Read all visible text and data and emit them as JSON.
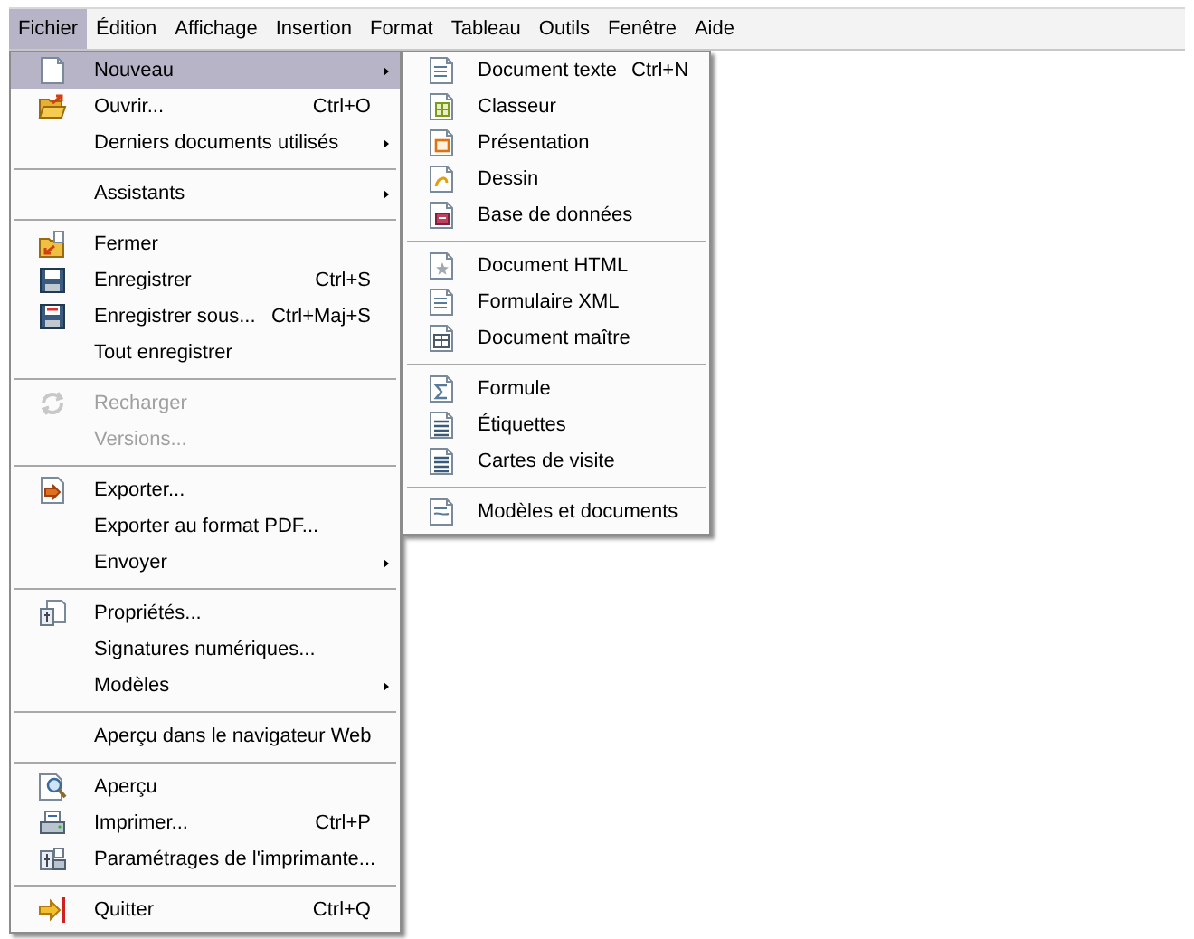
{
  "menu_bar": [
    {
      "label": "Fichier",
      "selected": true
    },
    {
      "label": "Édition",
      "selected": false
    },
    {
      "label": "Affichage",
      "selected": false
    },
    {
      "label": "Insertion",
      "selected": false
    },
    {
      "label": "Format",
      "selected": false
    },
    {
      "label": "Tableau",
      "selected": false
    },
    {
      "label": "Outils",
      "selected": false
    },
    {
      "label": "Fenêtre",
      "selected": false
    },
    {
      "label": "Aide",
      "selected": false
    }
  ],
  "file_menu": {
    "items": [
      {
        "kind": "item",
        "label": "Nouveau",
        "has_submenu": true,
        "disabled": false,
        "selected": true
      },
      {
        "kind": "item",
        "label": "Ouvrir...",
        "shortcut": "Ctrl+O",
        "has_submenu": false,
        "disabled": false,
        "selected": false
      },
      {
        "kind": "item",
        "label": "Derniers documents utilisés",
        "has_submenu": true,
        "disabled": false,
        "selected": false
      },
      {
        "kind": "separator"
      },
      {
        "kind": "item",
        "label": "Assistants",
        "has_submenu": true,
        "disabled": false,
        "selected": false
      },
      {
        "kind": "separator"
      },
      {
        "kind": "item",
        "label": "Fermer",
        "has_submenu": false,
        "disabled": false,
        "selected": false
      },
      {
        "kind": "item",
        "label": "Enregistrer",
        "shortcut": "Ctrl+S",
        "has_submenu": false,
        "disabled": false,
        "selected": false
      },
      {
        "kind": "item",
        "label": "Enregistrer sous...",
        "shortcut": "Ctrl+Maj+S",
        "has_submenu": false,
        "disabled": false,
        "selected": false
      },
      {
        "kind": "item",
        "label": "Tout enregistrer",
        "has_submenu": false,
        "disabled": false,
        "selected": false
      },
      {
        "kind": "separator"
      },
      {
        "kind": "item",
        "label": "Recharger",
        "has_submenu": false,
        "disabled": true,
        "selected": false
      },
      {
        "kind": "item",
        "label": "Versions...",
        "has_submenu": false,
        "disabled": true,
        "selected": false
      },
      {
        "kind": "separator"
      },
      {
        "kind": "item",
        "label": "Exporter...",
        "has_submenu": false,
        "disabled": false,
        "selected": false
      },
      {
        "kind": "item",
        "label": "Exporter au format PDF...",
        "has_submenu": false,
        "disabled": false,
        "selected": false
      },
      {
        "kind": "item",
        "label": "Envoyer",
        "has_submenu": true,
        "disabled": false,
        "selected": false
      },
      {
        "kind": "separator"
      },
      {
        "kind": "item",
        "label": "Propriétés...",
        "has_submenu": false,
        "disabled": false,
        "selected": false
      },
      {
        "kind": "item",
        "label": "Signatures numériques...",
        "has_submenu": false,
        "disabled": false,
        "selected": false
      },
      {
        "kind": "item",
        "label": "Modèles",
        "has_submenu": true,
        "disabled": false,
        "selected": false
      },
      {
        "kind": "separator"
      },
      {
        "kind": "item",
        "label": "Aperçu dans le navigateur Web",
        "has_submenu": false,
        "disabled": false,
        "selected": false
      },
      {
        "kind": "separator"
      },
      {
        "kind": "item",
        "label": "Aperçu",
        "has_submenu": false,
        "disabled": false,
        "selected": false
      },
      {
        "kind": "item",
        "label": "Imprimer...",
        "shortcut": "Ctrl+P",
        "has_submenu": false,
        "disabled": false,
        "selected": false
      },
      {
        "kind": "item",
        "label": "Paramétrages de l'imprimante...",
        "has_submenu": false,
        "disabled": false,
        "selected": false
      },
      {
        "kind": "separator"
      },
      {
        "kind": "item",
        "label": "Quitter",
        "shortcut": "Ctrl+Q",
        "has_submenu": false,
        "disabled": false,
        "selected": false
      }
    ]
  },
  "new_submenu": {
    "items": [
      {
        "kind": "item",
        "label": "Document texte",
        "shortcut": "Ctrl+N"
      },
      {
        "kind": "item",
        "label": "Classeur"
      },
      {
        "kind": "item",
        "label": "Présentation"
      },
      {
        "kind": "item",
        "label": "Dessin"
      },
      {
        "kind": "item",
        "label": "Base de données"
      },
      {
        "kind": "separator"
      },
      {
        "kind": "item",
        "label": "Document HTML"
      },
      {
        "kind": "item",
        "label": "Formulaire XML"
      },
      {
        "kind": "item",
        "label": "Document maître"
      },
      {
        "kind": "separator"
      },
      {
        "kind": "item",
        "label": "Formule"
      },
      {
        "kind": "item",
        "label": "Étiquettes"
      },
      {
        "kind": "item",
        "label": "Cartes de visite"
      },
      {
        "kind": "separator"
      },
      {
        "kind": "item",
        "label": "Modèles et documents"
      }
    ]
  }
}
